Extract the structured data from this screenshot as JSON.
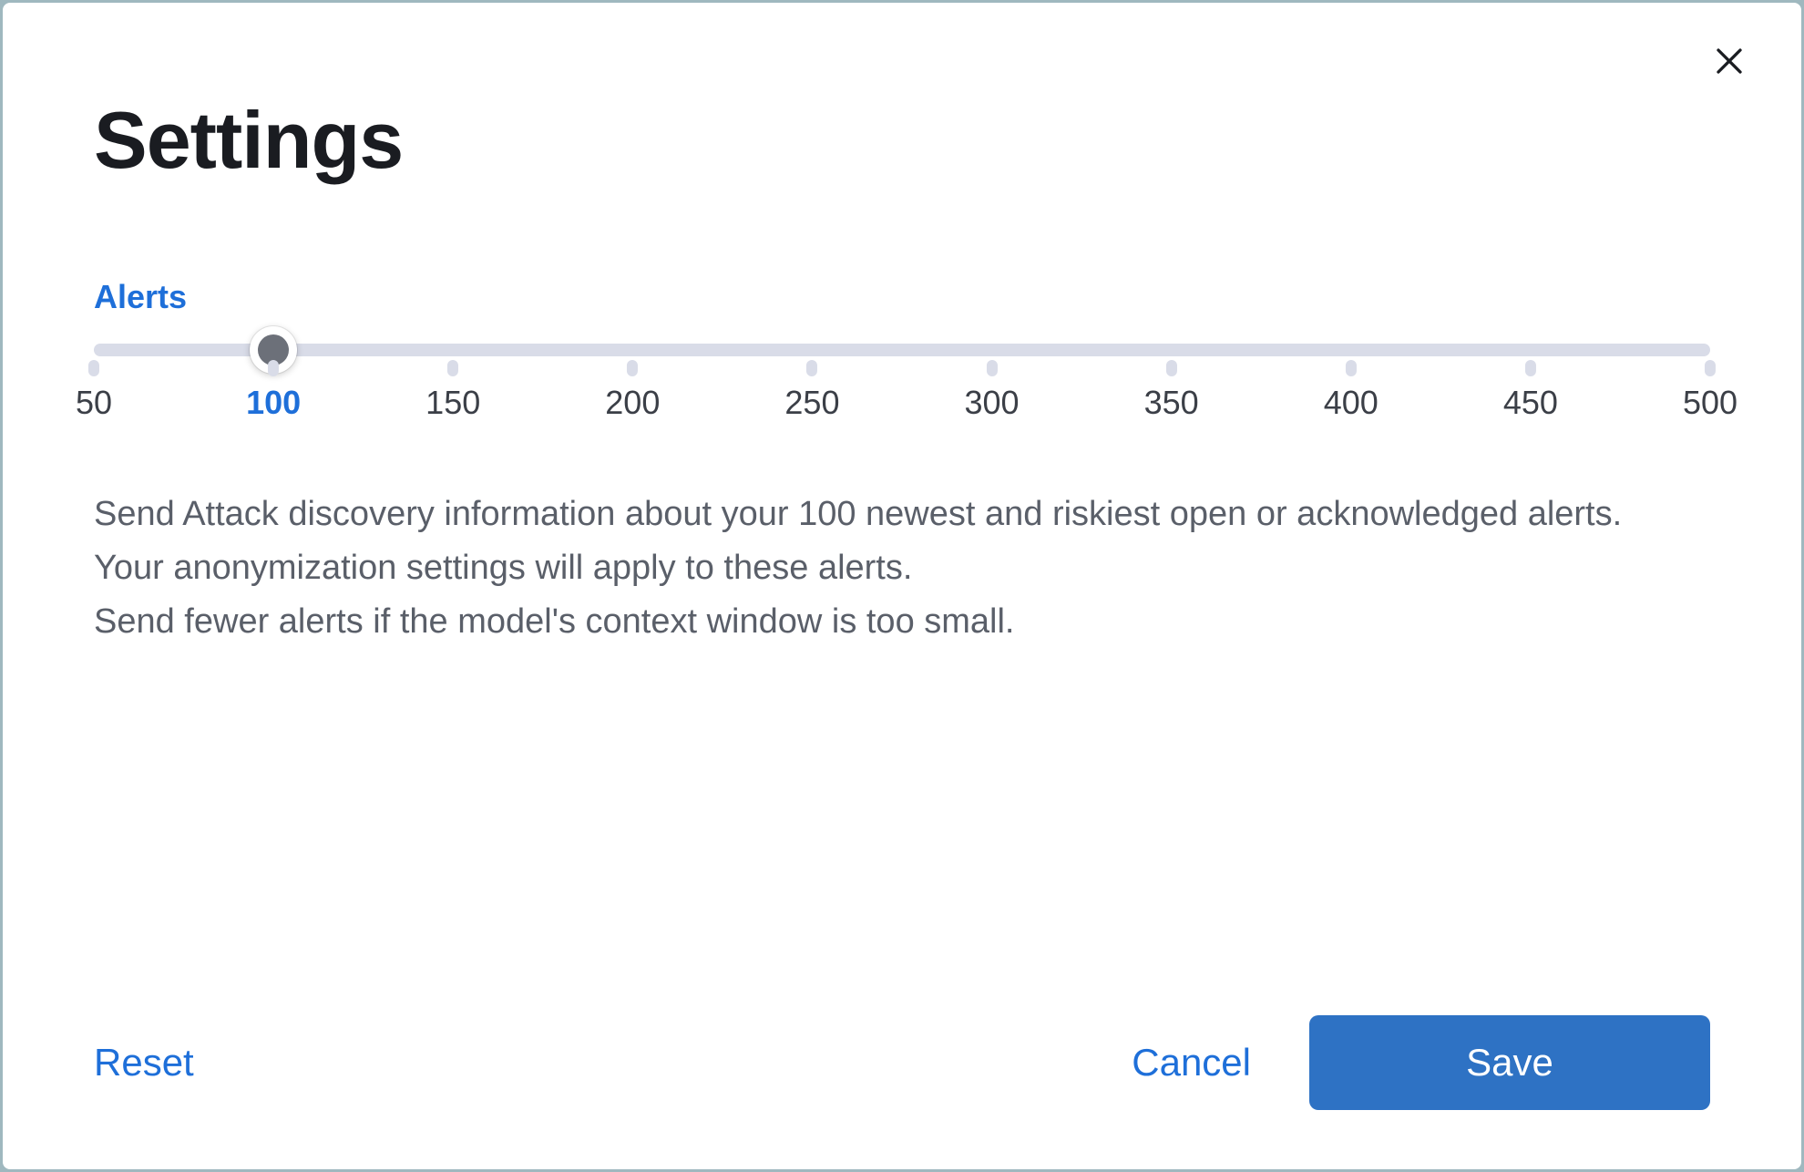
{
  "dialog": {
    "title": "Settings",
    "close_label": "Close"
  },
  "slider": {
    "section_label": "Alerts",
    "value": 100,
    "min": 50,
    "max": 500,
    "step": 50,
    "ticks": [
      {
        "value": 50,
        "label": "50"
      },
      {
        "value": 100,
        "label": "100"
      },
      {
        "value": 150,
        "label": "150"
      },
      {
        "value": 200,
        "label": "200"
      },
      {
        "value": 250,
        "label": "250"
      },
      {
        "value": 300,
        "label": "300"
      },
      {
        "value": 350,
        "label": "350"
      },
      {
        "value": 400,
        "label": "400"
      },
      {
        "value": 450,
        "label": "450"
      },
      {
        "value": 500,
        "label": "500"
      }
    ]
  },
  "description": {
    "line1": "Send Attack discovery information about your 100 newest and riskiest open or acknowledged alerts.",
    "line2": "Your anonymization settings will apply to these alerts.",
    "line3": "Send fewer alerts if the model's context window is too small."
  },
  "footer": {
    "reset_label": "Reset",
    "cancel_label": "Cancel",
    "save_label": "Save"
  },
  "colors": {
    "accent": "#1e6fd9",
    "primary_button": "#2e72c4",
    "text_dark": "#1a1c21",
    "text_muted": "#5a5f69",
    "track": "#d9dce8"
  }
}
